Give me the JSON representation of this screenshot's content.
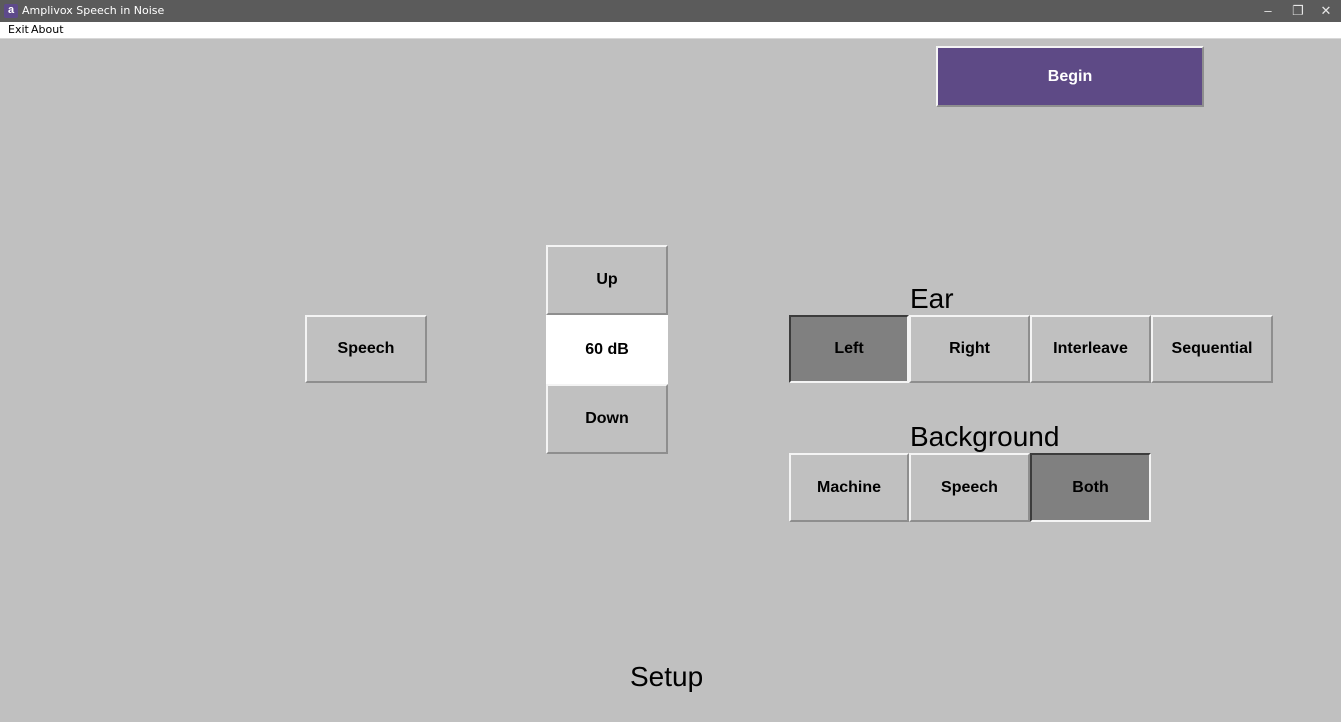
{
  "window": {
    "title": "Amplivox Speech in Noise",
    "app_icon": "a",
    "controls": {
      "minimize": "–",
      "maximize": "❐",
      "close": "✕"
    }
  },
  "menu": {
    "items": [
      "Exit",
      "About"
    ]
  },
  "begin_button": "Begin",
  "mode_button": "Speech",
  "level": {
    "up_label": "Up",
    "value": "60 dB",
    "down_label": "Down"
  },
  "ear": {
    "heading": "Ear",
    "options": [
      "Left",
      "Right",
      "Interleave",
      "Sequential"
    ],
    "selected": "Left"
  },
  "background": {
    "heading": "Background",
    "options": [
      "Machine",
      "Speech",
      "Both"
    ],
    "selected": "Both"
  },
  "screen_label": "Setup",
  "colors": {
    "canvas": "#c0c0c0",
    "accent": "#5e4a86",
    "selected": "#808080",
    "titlebar": "#5b5b5b"
  }
}
